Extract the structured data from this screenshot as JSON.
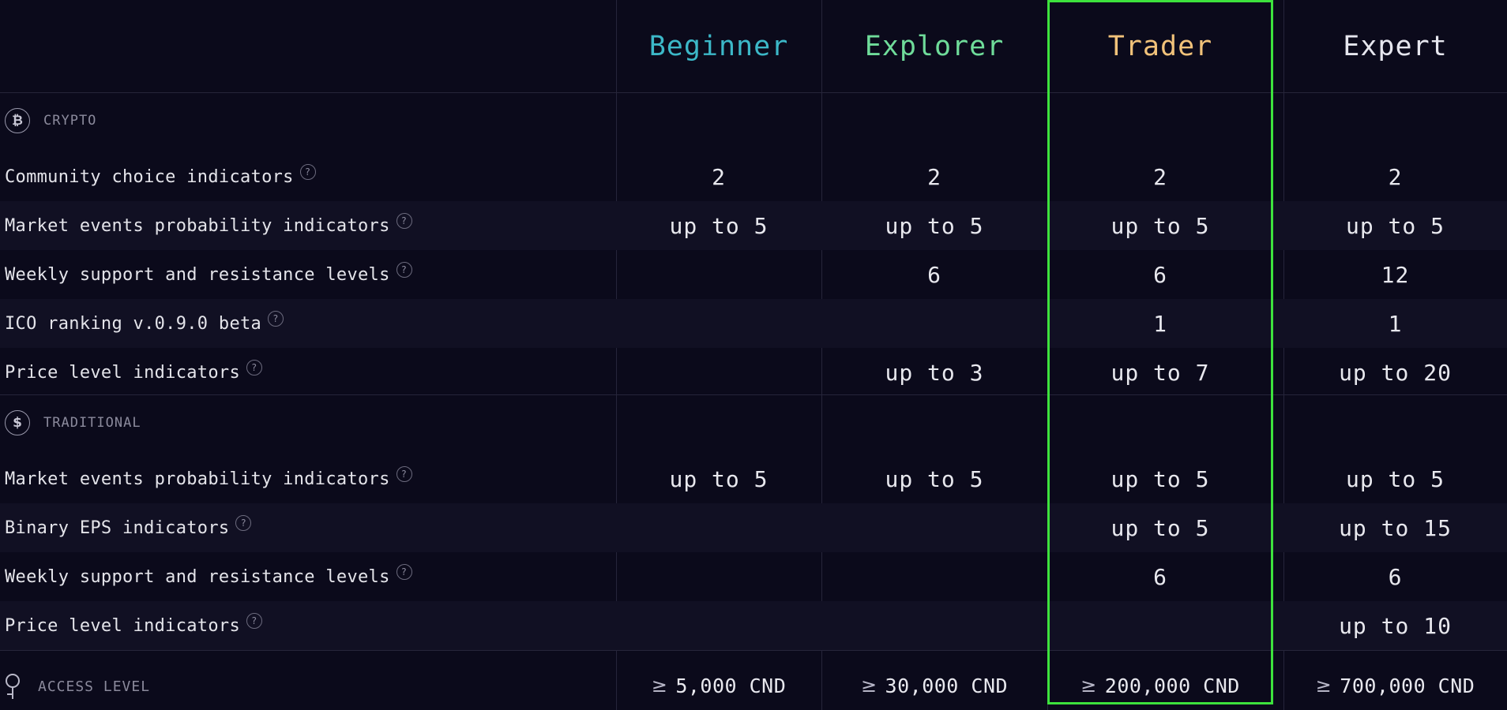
{
  "plans": [
    {
      "name": "Beginner",
      "color": "#3cb8c8"
    },
    {
      "name": "Explorer",
      "color": "#6fdc9a"
    },
    {
      "name": "Trader",
      "color": "#f1c27a"
    },
    {
      "name": "Expert",
      "color": "#e6e6ee"
    }
  ],
  "highlight_color": "#3de23d",
  "sections": [
    {
      "name": "CRYPTO",
      "icon": "bitcoin-icon",
      "rows": [
        {
          "label": "Community choice indicators",
          "values": [
            "2",
            "2",
            "2",
            "2"
          ]
        },
        {
          "label": "Market events probability indicators",
          "values": [
            "up to 5",
            "up to 5",
            "up to 5",
            "up to 5"
          ]
        },
        {
          "label": "Weekly support and resistance levels",
          "values": [
            "",
            "6",
            "6",
            "12"
          ]
        },
        {
          "label": "ICO ranking v.0.9.0 beta",
          "values": [
            "",
            "",
            "1",
            "1"
          ]
        },
        {
          "label": "Price level indicators",
          "values": [
            "",
            "up to 3",
            "up to 7",
            "up to 20"
          ]
        }
      ]
    },
    {
      "name": "TRADITIONAL",
      "icon": "dollar-icon",
      "rows": [
        {
          "label": "Market events probability indicators",
          "values": [
            "up to 5",
            "up to 5",
            "up to 5",
            "up to 5"
          ]
        },
        {
          "label": "Binary EPS indicators",
          "values": [
            "",
            "",
            "up to 5",
            "up to 15"
          ]
        },
        {
          "label": "Weekly support and resistance levels",
          "values": [
            "",
            "",
            "6",
            "6"
          ]
        },
        {
          "label": "Price level indicators",
          "values": [
            "",
            "",
            "",
            "up to 10"
          ]
        }
      ]
    }
  ],
  "access": {
    "label": "ACCESS LEVEL",
    "icon": "key-icon",
    "values": [
      "5,000 CND",
      "30,000 CND",
      "200,000 CND",
      "700,000 CND"
    ]
  },
  "help_glyph": "?",
  "section_glyphs": {
    "bitcoin": "₿",
    "dollar": "$"
  },
  "access_glyph": "≥"
}
